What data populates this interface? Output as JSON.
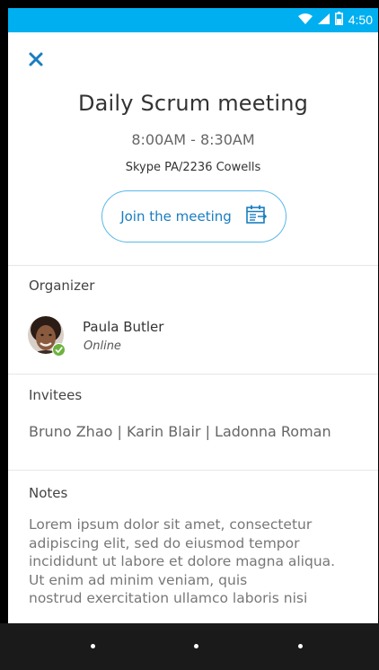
{
  "status_bar": {
    "time": "4:50",
    "background_color": "#00AFF0",
    "icons": [
      "wifi-icon",
      "signal-icon",
      "battery-icon"
    ]
  },
  "header": {
    "close_icon": "close-icon"
  },
  "meeting": {
    "title": "Daily Scrum meeting",
    "time_range": "8:00AM - 8:30AM",
    "location": "Skype PA/2236 Cowells",
    "join_label": "Join the meeting",
    "join_icon": "calendar-join-icon",
    "accent_color": "#1A7DC0"
  },
  "organizer": {
    "label": "Organizer",
    "name": "Paula Butler",
    "status": "Online",
    "presence_color": "#6CB33E"
  },
  "invitees": {
    "label": "Invitees",
    "list": "Bruno Zhao |  Karin Blair | Ladonna Roman"
  },
  "notes": {
    "label": "Notes",
    "body": "Lorem ipsum dolor sit amet, consectetur\nadipiscing elit, sed do eiusmod tempor\nincididunt ut labore et  dolore magna aliqua.\nUt enim ad minim veniam, quis\nnostrud exercitation ullamco laboris nisi"
  }
}
